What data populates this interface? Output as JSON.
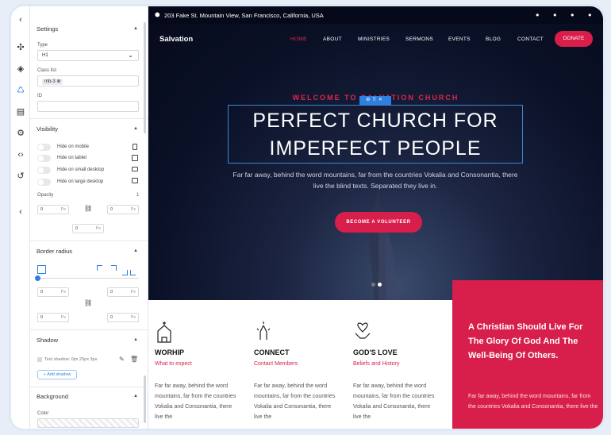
{
  "panel": {
    "settings_title": "Settings",
    "type_label": "Type",
    "type_value": "H1",
    "class_label": "Class list",
    "class_chip": "mb-3",
    "id_label": "ID",
    "visibility_title": "Visibility",
    "hide_mobile": "Hide on mobile",
    "hide_tablet": "Hide on tablet",
    "hide_small": "Hide on small desktop",
    "hide_large": "Hide on large desktop",
    "opacity_label": "Opacity",
    "opacity_value": "1",
    "spacing_values": [
      "0",
      "0",
      "0"
    ],
    "unit": "Px",
    "border_title": "Border radius",
    "radius_values": [
      "0",
      "0",
      "0",
      "0"
    ],
    "shadow_title": "Shadow",
    "shadow_item": "Text shadow: 0px 25px 3px",
    "add_shadow": "+ Add shadow",
    "background_title": "Background",
    "color_label": "Color"
  },
  "site": {
    "address": "203 Fake St. Mountain View, San Francisco, California, USA",
    "brand": "Salvation",
    "nav": [
      "HOME",
      "ABOUT",
      "MINISTRIES",
      "SERMONS",
      "EVENTS",
      "BLOG",
      "CONTACT"
    ],
    "donate": "DONATE",
    "welcome": "WELCOME TO SALVATION CHURCH",
    "title_line1": "PERFECT CHURCH FOR",
    "title_line2": "IMPERFECT PEOPLE",
    "description": "Far far away, behind the word mountains, far from the countries Vokalia and Consonantia, there live the blind texts. Separated they live in.",
    "cta": "BECOME A VOLUNTEER",
    "cards": [
      {
        "title": "WORHIP",
        "sub": "What to expect",
        "text": "Far far away, behind the word mountains, far from the countries Vokalia and Consonantia, there live the"
      },
      {
        "title": "CONNECT",
        "sub": "Contact Members",
        "text": "Far far away, behind the word mountains, far from the countries Vokalia and Consonantia, there live the"
      },
      {
        "title": "GOD'S LOVE",
        "sub": "Beliefs and History",
        "text": "Far far away, behind the word mountains, far from the countries Vokalia and Consonantia, there live the"
      }
    ],
    "red_heading": "A Christian Should Live For The Glory Of God And The Well-Being Of Others.",
    "red_text": "Far far away, behind the word mountains, far from the countries Vokalia and Consonantia, there live the"
  },
  "colors": {
    "accent": "#d81e4a",
    "hero_dark": "#0a1026",
    "selection": "#3a86d4"
  }
}
